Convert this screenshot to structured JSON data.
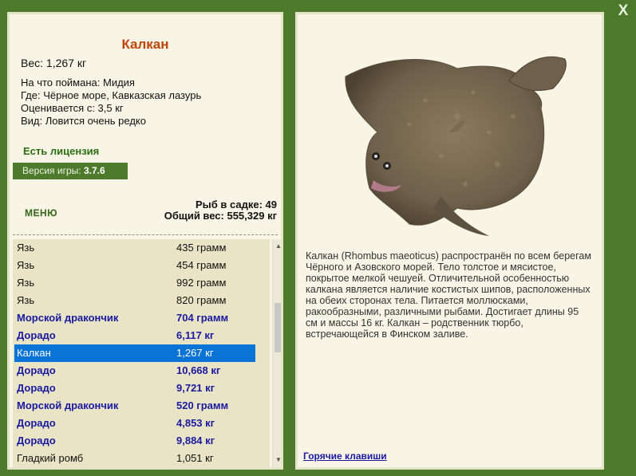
{
  "close_label": "X",
  "fish": {
    "title": "Калкан",
    "weight_line": "Вес: 1,267 кг",
    "caught_on": "На что поймана: Мидия",
    "location": "Где: Чёрное море, Кавказская лазурь",
    "valued_from": "Оценивается с: 3,5 кг",
    "kind": "Вид: Ловится очень редко"
  },
  "license": "Есть лицензия",
  "version": {
    "label": "Версия игры:",
    "value": "3.7.6"
  },
  "menu_label": "МЕНЮ",
  "stats": {
    "fish_in_net": "Рыб в садке: 49",
    "total_weight": "Общий вес: 555,329 кг"
  },
  "catch_list": [
    {
      "name": "Язь",
      "weight": "435 грамм",
      "notable": false,
      "selected": false
    },
    {
      "name": "Язь",
      "weight": "454 грамм",
      "notable": false,
      "selected": false
    },
    {
      "name": "Язь",
      "weight": "992 грамм",
      "notable": false,
      "selected": false
    },
    {
      "name": "Язь",
      "weight": "820 грамм",
      "notable": false,
      "selected": false
    },
    {
      "name": "Морской дракончик",
      "weight": "704 грамм",
      "notable": true,
      "selected": false
    },
    {
      "name": "Дорадо",
      "weight": "6,117 кг",
      "notable": true,
      "selected": false
    },
    {
      "name": "Калкан",
      "weight": "1,267 кг",
      "notable": false,
      "selected": true
    },
    {
      "name": "Дорадо",
      "weight": "10,668 кг",
      "notable": true,
      "selected": false
    },
    {
      "name": "Дорадо",
      "weight": "9,721 кг",
      "notable": true,
      "selected": false
    },
    {
      "name": "Морской дракончик",
      "weight": "520 грамм",
      "notable": true,
      "selected": false
    },
    {
      "name": "Дорадо",
      "weight": "4,853 кг",
      "notable": true,
      "selected": false
    },
    {
      "name": "Дорадо",
      "weight": "9,884 кг",
      "notable": true,
      "selected": false
    },
    {
      "name": "Гладкий ромб",
      "weight": "1,051 кг",
      "notable": false,
      "selected": false
    }
  ],
  "description": "Калкан (Rhombus maeoticus) распространён по всем берегам Чёрного и Азовского морей. Тело толстое и мясистое, покрытое мелкой чешуей. Отличительной особенностью калкана является наличие костистых шипов, расположенных на обеих сторонах тела. Питается моллюсками, ракообразными, различными рыбами. Достигает длины 95 см и массы 16 кг. Калкан – родственник тюрбо, встречающейся в Финском заливе.",
  "hotkeys_label": "Горячие клавиши",
  "colors": {
    "background": "#4e7a2c",
    "title": "#bf4408",
    "selected_row": "#0a74d6",
    "notable_text": "#1a1aa0"
  }
}
